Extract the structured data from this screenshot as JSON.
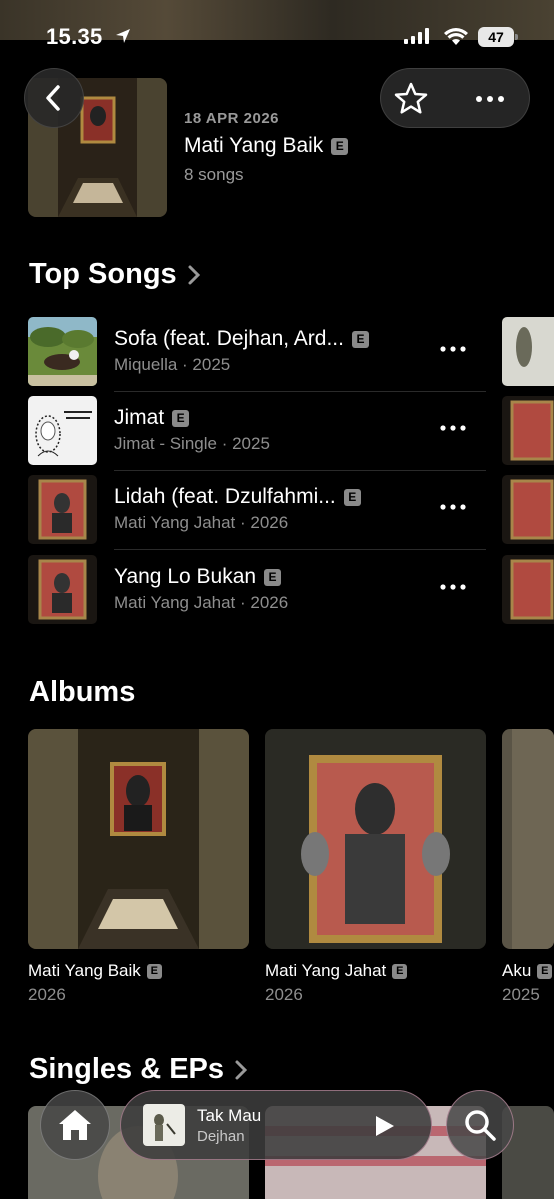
{
  "status_bar": {
    "time": "15.35",
    "battery": "47"
  },
  "release": {
    "date": "18 APR 2026",
    "title": "Mati Yang Baik",
    "explicit": "E",
    "count": "8 songs"
  },
  "top_songs": {
    "heading": "Top Songs",
    "items": [
      {
        "title": "Sofa (feat. Dejhan, Ard...",
        "explicit": "E",
        "subtitle": "Miquella · 2025"
      },
      {
        "title": "Jimat",
        "explicit": "E",
        "subtitle": "Jimat - Single · 2025"
      },
      {
        "title": "Lidah (feat. Dzulfahmi...",
        "explicit": "E",
        "subtitle": "Mati Yang Jahat · 2026"
      },
      {
        "title": "Yang Lo Bukan",
        "explicit": "E",
        "subtitle": "Mati Yang Jahat · 2026"
      }
    ]
  },
  "albums": {
    "heading": "Albums",
    "items": [
      {
        "title": "Mati Yang Baik",
        "explicit": "E",
        "year": "2026"
      },
      {
        "title": "Mati Yang Jahat",
        "explicit": "E",
        "year": "2026"
      },
      {
        "title": "Aku",
        "explicit": "E",
        "year": "2025"
      }
    ]
  },
  "singles": {
    "heading": "Singles & EPs"
  },
  "now_playing": {
    "title": "Tak Mau",
    "artist": "Dejhan"
  },
  "icons": {
    "back": "chevron-left-icon",
    "favorite": "star-icon",
    "more": "ellipsis-icon",
    "home": "home-icon",
    "play": "play-icon",
    "search": "search-icon"
  }
}
